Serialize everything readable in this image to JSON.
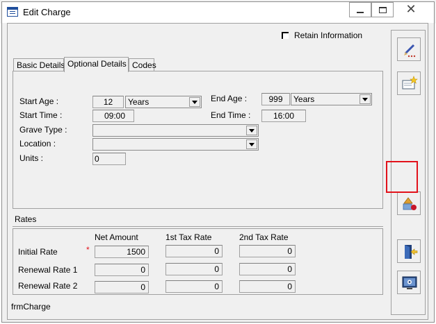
{
  "window": {
    "title": "Edit Charge",
    "icon": "form-icon",
    "controls": [
      "minimize-icon",
      "maximize-icon",
      "close-icon"
    ]
  },
  "retain_information": {
    "label": "Retain Information",
    "checked": false
  },
  "tabs": [
    {
      "label": "Basic Details",
      "active": false
    },
    {
      "label": "Optional Details",
      "active": true
    },
    {
      "label": "Codes",
      "active": false
    }
  ],
  "optional": {
    "start_age": {
      "label": "Start Age :",
      "value": "12",
      "unit": "Years"
    },
    "end_age": {
      "label": "End Age :",
      "value": "999",
      "unit": "Years"
    },
    "start_time": {
      "label": "Start Time :",
      "value": "09:00"
    },
    "end_time": {
      "label": "End Time :",
      "value": "16:00"
    },
    "grave_type": {
      "label": "Grave Type :",
      "value": ""
    },
    "location": {
      "label": "Location :",
      "value": ""
    },
    "units": {
      "label": "Units :",
      "value": "0"
    }
  },
  "rates": {
    "title": "Rates",
    "columns": [
      "Net Amount",
      "1st Tax Rate",
      "2nd Tax Rate"
    ],
    "required_marker": "*",
    "rows": [
      {
        "label": "Initial Rate",
        "net": "1500",
        "tax1": "0",
        "tax2": "0"
      },
      {
        "label": "Renewal Rate 1",
        "net": "0",
        "tax1": "0",
        "tax2": "0"
      },
      {
        "label": "Renewal Rate 2",
        "net": "0",
        "tax1": "0",
        "tax2": "0"
      }
    ]
  },
  "status": {
    "form_name": "frmCharge"
  },
  "toolbar": {
    "buttons": [
      "edit-icon",
      "new-icon",
      "shapes-delete-icon",
      "exit-icon",
      "screen-icon"
    ],
    "highlight_color": "#e2111a"
  },
  "colors": {
    "window_bg": "#f0f0f0",
    "border": "#a0a0a0",
    "required": "#e2111a"
  }
}
